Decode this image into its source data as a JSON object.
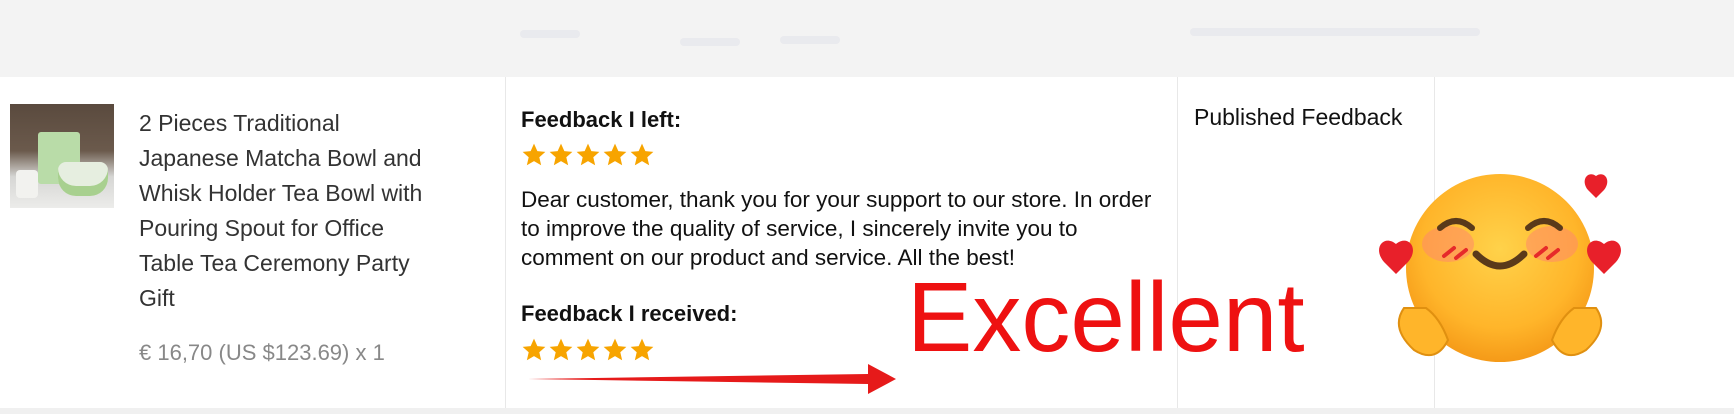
{
  "order_item": {
    "title": "2 Pieces Traditional Japanese Matcha Bowl and Whisk Holder Tea Bowl with Pouring Spout for Office Table Tea Ceremony Party Gift",
    "price": "€ 16,70 (US $123.69) x 1"
  },
  "feedback": {
    "left_label": "Feedback I left:",
    "left_rating": 5,
    "left_text": "Dear customer, thank you for your support to our store. In order to improve the quality of service, I sincerely invite you to comment on our product and service. All the best!",
    "received_label": "Feedback I received:",
    "received_rating": 5
  },
  "status": {
    "text": "Published Feedback"
  },
  "overlay": {
    "excellent_text": "Excellent"
  },
  "colors": {
    "star": "#f7a400",
    "overlay_red": "#ee1111",
    "arrow_red": "#e61a1a"
  }
}
